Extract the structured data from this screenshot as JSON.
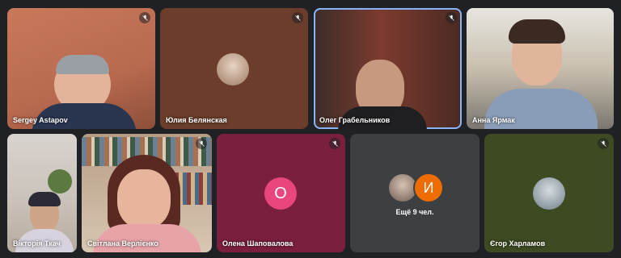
{
  "colors": {
    "background": "#202124",
    "active_outline": "#8ab4f8",
    "mute_icon": "#ffffff",
    "avatar_pink": "#e8467c",
    "avatar_orange": "#ef6c00"
  },
  "tiles": [
    {
      "name": "Sergey Astapov",
      "muted": true,
      "active": false,
      "icon": "mic-off-icon"
    },
    {
      "name": "Юлия Белянская",
      "muted": true,
      "active": false,
      "icon": "mic-off-icon"
    },
    {
      "name": "Олег Грабельников",
      "muted": true,
      "active": true,
      "icon": "mic-off-icon"
    },
    {
      "name": "Анна Ярмак",
      "muted": false,
      "active": false
    },
    {
      "name": "Вікторія Ткач",
      "muted": false,
      "active": false
    },
    {
      "name": "Світлана Верлієнко",
      "muted": true,
      "active": false,
      "icon": "mic-off-icon"
    },
    {
      "name": "Олена Шаповалова",
      "muted": true,
      "active": false,
      "avatar_letter": "О",
      "icon": "mic-off-icon"
    },
    {
      "name": "",
      "overflow_label": "Ещё 9 чел.",
      "avatar_letter": "И"
    },
    {
      "name": "Єгор Харламов",
      "muted": true,
      "active": false,
      "icon": "mic-off-icon"
    }
  ]
}
